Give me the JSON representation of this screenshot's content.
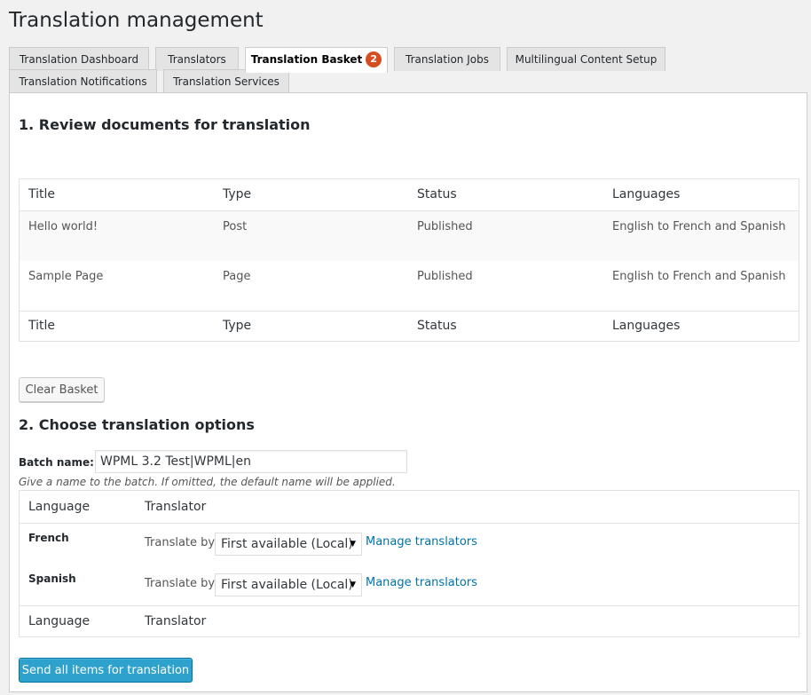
{
  "page": {
    "title": "Translation management"
  },
  "tabs": [
    {
      "label": "Translation Dashboard"
    },
    {
      "label": "Translators"
    },
    {
      "label": "Translation Basket",
      "badge": "2"
    },
    {
      "label": "Translation Jobs"
    },
    {
      "label": "Multilingual Content Setup"
    },
    {
      "label": "Translation Notifications"
    },
    {
      "label": "Translation Services"
    }
  ],
  "review": {
    "heading": "1. Review documents for translation",
    "columns": [
      "Title",
      "Type",
      "Status",
      "Languages"
    ],
    "rows": [
      {
        "title": "Hello world!",
        "type": "Post",
        "status": "Published",
        "languages": "English to French and Spanish"
      },
      {
        "title": "Sample Page",
        "type": "Page",
        "status": "Published",
        "languages": "English to French and Spanish"
      }
    ],
    "clear_button": "Clear Basket"
  },
  "options": {
    "heading": "2. Choose translation options",
    "batch_label": "Batch name:",
    "batch_value": "WPML 3.2 Test|WPML|en",
    "batch_hint": "Give a name to the batch. If omitted, the default name will be applied.",
    "columns": [
      "Language",
      "Translator"
    ],
    "languages": [
      {
        "name": "French",
        "translate_by_label": "Translate by",
        "selected": "First available (Local)",
        "manage_link": "Manage translators"
      },
      {
        "name": "Spanish",
        "translate_by_label": "Translate by",
        "selected": "First available (Local)",
        "manage_link": "Manage translators"
      }
    ],
    "send_button": "Send all items for translation"
  },
  "colors": {
    "badge": "#d54e21",
    "primary_button": "#2ea2cc",
    "link": "#0073aa",
    "alt_row": "#f9f9f9"
  }
}
